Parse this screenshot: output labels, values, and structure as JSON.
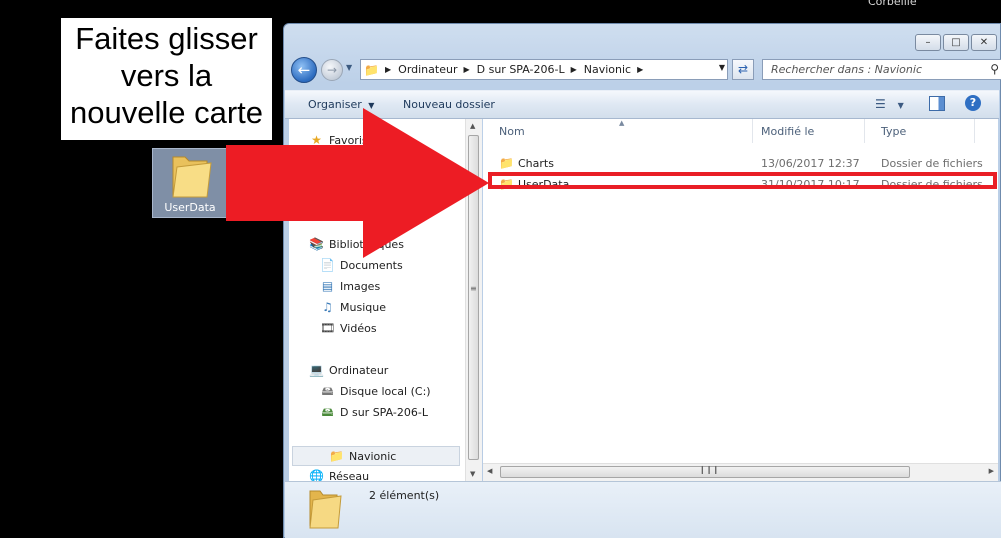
{
  "desktop": {
    "recycle_bin_label": "Corbeille",
    "instruction": [
      "Faites glisser",
      "vers la",
      "nouvelle carte"
    ],
    "dragged_folder_label": "UserData"
  },
  "window": {
    "address_crumbs": [
      "Ordinateur",
      "D sur SPA-206-L",
      "Navionic"
    ],
    "search_placeholder": "Rechercher dans : Navionic",
    "toolbar": {
      "organize": "Organiser",
      "new_folder": "Nouveau dossier"
    },
    "nav": {
      "favorites": "Favoris",
      "libraries": "Bibliothèques",
      "library_items": [
        "Documents",
        "Images",
        "Musique",
        "Vidéos"
      ],
      "computer": "Ordinateur",
      "computer_items": [
        "Disque local (C:)",
        "D sur SPA-206-L",
        "Navionic"
      ],
      "network": "Réseau"
    },
    "columns": {
      "name": "Nom",
      "modified": "Modifié le",
      "type": "Type"
    },
    "files": [
      {
        "name": "Charts",
        "modified": "13/06/2017 12:37",
        "type": "Dossier de fichiers"
      },
      {
        "name": "UserData",
        "modified": "31/10/2017 10:17",
        "type": "Dossier de fichiers"
      }
    ],
    "status": "2 élément(s)"
  },
  "colors": {
    "highlight_red": "#e91e25",
    "arrow_red": "#ed1c24"
  }
}
